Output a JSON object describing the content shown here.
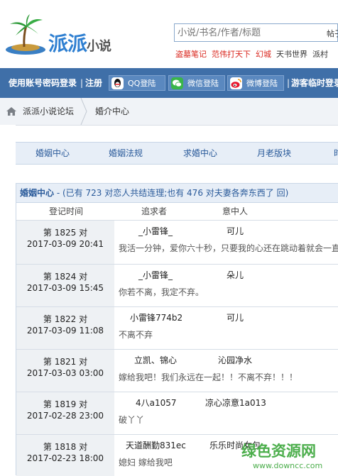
{
  "header": {
    "logo_text": "派派",
    "logo_small": "小说",
    "search_placeholder": "小说/书名/作者/标题",
    "search_type": "帖子",
    "hotwords": [
      {
        "text": "盗墓笔记",
        "color": "#d9241b"
      },
      {
        "text": "范伟打天下",
        "color": "#d9241b"
      },
      {
        "text": "幻城",
        "color": "#d9241b"
      },
      {
        "text": "天书世界",
        "color": "#333333"
      },
      {
        "text": "派村",
        "color": "#333333"
      }
    ]
  },
  "loginbar": {
    "account_login": "使用账号密码登录",
    "divider": "|",
    "register": "注册",
    "qq": "QQ登陆",
    "wechat": "微信登陆",
    "weibo": "微博登陆",
    "guest": "游客临时登录"
  },
  "breadcrumb": {
    "forum": "派派小说论坛",
    "current": "婚介中心"
  },
  "tabs": [
    "婚姻中心",
    "婚姻法规",
    "求婚中心",
    "月老版块",
    "时"
  ],
  "panel": {
    "title": "婚姻中心",
    "summary": " - (已有 723 对恋人共结连理;也有 476 对夫妻各奔东西了 回)",
    "col_date": "登记时间",
    "col_suitor": "追求者",
    "col_target": "意中人"
  },
  "rows": [
    {
      "rank": "第 1825 对",
      "date": "2017-03-09 20:41",
      "suitor": "_小雷锋_",
      "target": "可儿",
      "msg": "我活一分钟，爱你六十秒，只要我的心还在跳动着就会一直"
    },
    {
      "rank": "第 1824 对",
      "date": "2017-03-09 15:45",
      "suitor": "_小雷锋_",
      "target": "朵儿",
      "msg": "你若不离，我定不弃。"
    },
    {
      "rank": "第 1822 对",
      "date": "2017-03-09 11:08",
      "suitor": "小雷锋774b2",
      "target": "可儿",
      "msg": "不离不弃"
    },
    {
      "rank": "第 1821 对",
      "date": "2017-03-03 03:00",
      "suitor": "立凯、锦心",
      "target": "沁园净水",
      "msg": "嫁给我吧！我们永远在一起！！不离不弃！！！"
    },
    {
      "rank": "第 1819 对",
      "date": "2017-02-28 23:00",
      "suitor": "4八a1057",
      "target": "凉心凉意1a013",
      "msg": "破丫丫"
    },
    {
      "rank": "第 1818 对",
      "date": "2017-02-23 18:00",
      "suitor": "天道酬勤831ec",
      "target": "乐乐时尚女包",
      "msg": "媳妇 嫁给我吧"
    }
  ],
  "watermark": {
    "text": "绿色资源网",
    "url": "www.downcc.com"
  }
}
